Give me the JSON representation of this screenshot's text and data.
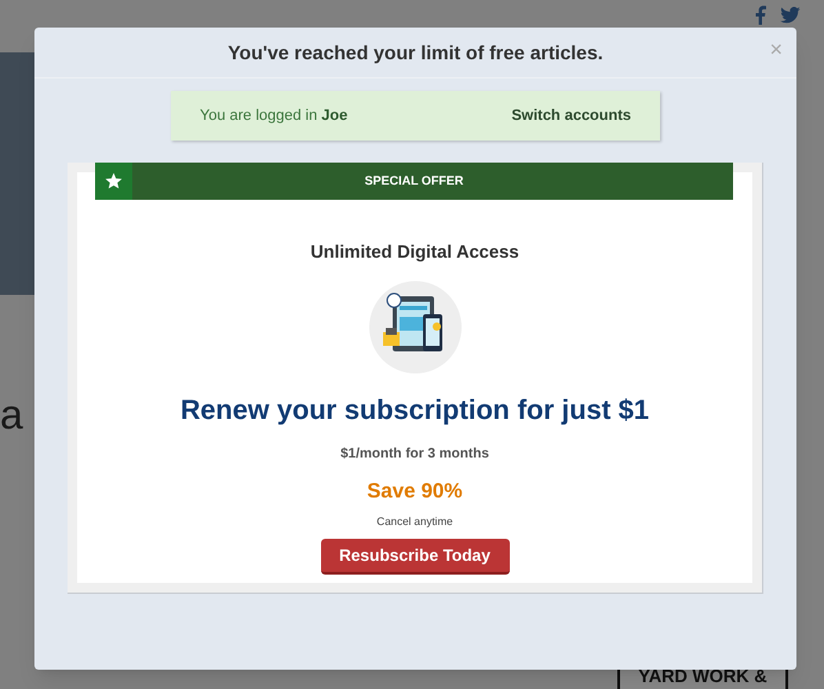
{
  "background": {
    "heading_fragment": "a",
    "ad_text": "YARD WORK &"
  },
  "modal": {
    "title": "You've reached your limit of free articles.",
    "close": "×"
  },
  "login": {
    "text": "You are logged in",
    "user": "Joe",
    "switch": "Switch accounts"
  },
  "offer": {
    "banner": "SPECIAL OFFER",
    "product": "Unlimited Digital Access",
    "headline": "Renew your subscription for just $1",
    "price": "$1/month for 3 months",
    "savings": "Save 90%",
    "note": "Cancel anytime",
    "button": "Resubscribe Today"
  }
}
